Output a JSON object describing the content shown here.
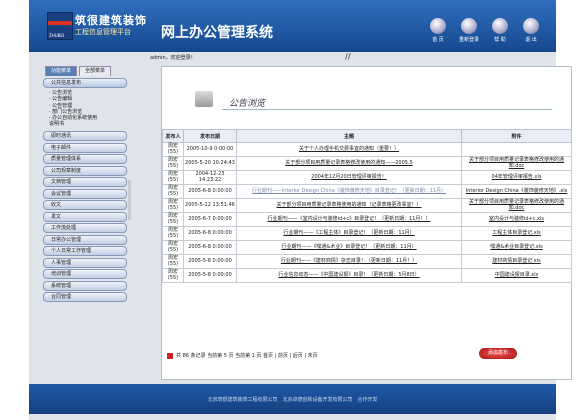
{
  "header": {
    "brand_name": "筑很建筑装饰",
    "brand_sub": "工程信息管理平台",
    "logo_text": "ZHUBEI",
    "system_title": "网上办公管理系统",
    "nav": [
      {
        "label": "首 页",
        "icon": "home-icon"
      },
      {
        "label": "重新登录",
        "icon": "relogin-icon"
      },
      {
        "label": "帮 助",
        "icon": "help-icon"
      },
      {
        "label": "退 出",
        "icon": "exit-icon"
      }
    ]
  },
  "welcome": "admin，欢迎登录！",
  "slash": "//",
  "sidebar": {
    "tabs": [
      "功能菜单",
      "全部菜单"
    ],
    "active_menu": "公共信息发布",
    "sub_items": [
      "· 公告浏览",
      "· 公告编辑",
      "· 公告管理",
      "· 部门公告浏览",
      "· 办公自动化系统使用",
      "  说明书"
    ],
    "menu_items": [
      "即时通讯",
      "电子邮件",
      "质量管理体系",
      "公司规章制度",
      "文档管理",
      "会议管理",
      "收文",
      "发文",
      "工作流处理",
      "日常办公管理",
      "个人日常工作管理",
      "人事管理",
      "培训管理",
      "系统管理",
      "合同管理"
    ]
  },
  "content": {
    "title": "公告浏览",
    "columns": [
      "发布人",
      "发布日期",
      "主题",
      "附件"
    ],
    "rows": [
      {
        "author": "周宏(55)",
        "date": "2005-10-9 0:00:00",
        "subject": "关于个人办理手机交费事宜的通知（重要！）",
        "subject_style": "lnk",
        "attachment": ""
      },
      {
        "author": "周宏(55)",
        "date": "2005-5-20 10:24:43",
        "subject": "关于部分项目用质量记录表格修改使用的通知——2005.5",
        "subject_style": "lnk",
        "attachment": "关于部分项目用质量记录表格修改使用的通知.doc"
      },
      {
        "author": "周宏(55)",
        "date": "2004-12-23 14:23:22",
        "subject": "2004年12月20日管理评审报告！",
        "subject_style": "lnk",
        "attachment": "04年管理评审报告.xls"
      },
      {
        "author": "周宏(55)",
        "date": "2005-6-8 0:00:00",
        "subject": "行业期刊——Interior Design China《装饰装修天地》目录登记！（更新日期：11月）",
        "subject_style": "dim",
        "attachment": "Interior Design China《装饰装修天地》.xls"
      },
      {
        "author": "周宏(55)",
        "date": "2005-5-12 13:51:46",
        "subject": "关于部分项目用质量记录表格使用的通知（记录表格更改事宜！）",
        "subject_style": "lnk",
        "attachment": "关于部分项目用质量记录表格修改使用的通知.doc"
      },
      {
        "author": "周宏(55)",
        "date": "2005-6-7 0:00:00",
        "subject": "行业期刊——《室内设计与装修id+c》目录登记！（更新日期：11月！）",
        "subject_style": "lnk",
        "attachment": "室内设计与装修id+c.xls"
      },
      {
        "author": "周宏(55)",
        "date": "2005-6-8 0:00:00",
        "subject": "行业期刊——《工程主体》目录登记！（更新日期：11月）",
        "subject_style": "lnk",
        "attachment": "工程主体目录登记.xls"
      },
      {
        "author": "周宏(55)",
        "date": "2005-6-8 0:00:00",
        "subject": "行业期刊——《嘿通&术业》目录登记！（更新日期：11月）",
        "subject_style": "lnk",
        "attachment": "嘿通&术业目录登记.xls"
      },
      {
        "author": "周宏(55)",
        "date": "2005-5-8 0:00:00",
        "subject": "行业期刊——《建材商情》杂志目录！（更新日期：11月！）",
        "subject_style": "lnk",
        "attachment": "建材商情目录登记.xls"
      },
      {
        "author": "周宏(55)",
        "date": "2005-5-8 0:00:00",
        "subject": "行业信息动态——《中国建设报》目录！（更新日期：5月8日）",
        "subject_style": "lnk",
        "attachment": "中国建设报目录.xls"
      }
    ],
    "pager": "共 86 条记录 当前第 5 页 当前第 1 页    首页 | 前页 | 后页 | 末页",
    "add_button": "添加发布"
  },
  "footer": "北京筑很建筑装饰工程有限公司　北京卓德创新设备开发有限公司　合作开发",
  "colors": {
    "header": "#16488f",
    "accent": "#c22"
  }
}
